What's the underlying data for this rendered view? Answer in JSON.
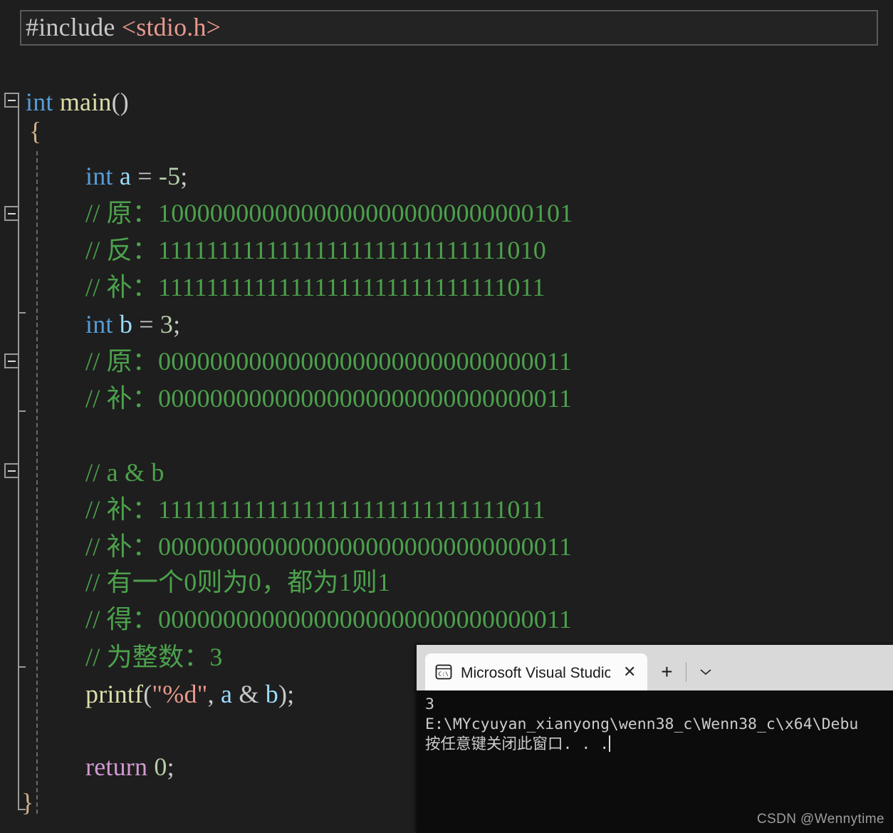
{
  "editor": {
    "language": "c",
    "theme_bg": "#1e1e1e",
    "current_line_index": 0,
    "lines": [
      {
        "indent": 0,
        "text": "#include <stdio.h>"
      },
      {
        "indent": 0,
        "text": ""
      },
      {
        "indent": 0,
        "text": "int main()"
      },
      {
        "indent": 0,
        "text": "{"
      },
      {
        "indent": 1,
        "text": ""
      },
      {
        "indent": 1,
        "text": "int a = -5;"
      },
      {
        "indent": 1,
        "text": "// 原：10000000000000000000000000000101"
      },
      {
        "indent": 1,
        "text": "// 反：11111111111111111111111111111010"
      },
      {
        "indent": 1,
        "text": "// 补：11111111111111111111111111111011"
      },
      {
        "indent": 1,
        "text": "int b = 3;"
      },
      {
        "indent": 1,
        "text": "// 原：00000000000000000000000000000011"
      },
      {
        "indent": 1,
        "text": "// 补：00000000000000000000000000000011"
      },
      {
        "indent": 1,
        "text": ""
      },
      {
        "indent": 1,
        "text": "// a & b"
      },
      {
        "indent": 1,
        "text": "// 补：11111111111111111111111111111011"
      },
      {
        "indent": 1,
        "text": "// 补：00000000000000000000000000000011"
      },
      {
        "indent": 1,
        "text": "// 有一个0则为0，都为1则1"
      },
      {
        "indent": 1,
        "text": "// 得：00000000000000000000000000000011"
      },
      {
        "indent": 1,
        "text": "// 为整数：3"
      },
      {
        "indent": 1,
        "text": "printf(\"%d\", a & b);"
      },
      {
        "indent": 1,
        "text": ""
      },
      {
        "indent": 1,
        "text": "return 0;"
      },
      {
        "indent": 0,
        "text": "}"
      }
    ],
    "tokens": {
      "preprocessor": "#include",
      "header": "<stdio.h>",
      "kw_int": "int",
      "fn_main": "main",
      "fn_printf": "printf",
      "kw_return": "return",
      "var_a": "a",
      "var_b": "b",
      "num_neg5": "-5",
      "num_3": "3",
      "num_0": "0",
      "fmt_string": "\"%d\"",
      "open_brace": "{",
      "close_brace": "}",
      "comment_yuan_a": "// 原：10000000000000000000000000000101",
      "comment_fan_a": "// 反：11111111111111111111111111111010",
      "comment_bu_a": "// 补：11111111111111111111111111111011",
      "comment_yuan_b": "// 原：00000000000000000000000000000011",
      "comment_bu_b": "// 补：00000000000000000000000000000011",
      "comment_and": "// a & b",
      "comment_bu_a2": "// 补：11111111111111111111111111111011",
      "comment_bu_b2": "// 补：00000000000000000000000000000011",
      "comment_rule": "// 有一个0则为0，都为1则1",
      "comment_de": "// 得：00000000000000000000000000000011",
      "comment_result": "// 为整数：3"
    },
    "colors": {
      "background": "#1e1e1e",
      "keyword": "#569cd6",
      "function": "#dcdcaa",
      "comment": "#4ca14c",
      "string": "#e8998d",
      "number": "#b5cea8",
      "variable": "#9cdcfe",
      "return_keyword": "#d19ad1",
      "punctuation": "#c8c8c8",
      "brace": "#d2b48c",
      "gutter_fold": "#9a9a9a",
      "indent_guide": "#6a6a6a",
      "current_line_border": "#5a5a5a"
    }
  },
  "terminal": {
    "tab": {
      "icon": "command-prompt-icon",
      "title": "Microsoft Visual Studio 调试控制台",
      "title_visible": "Microsoft Visual Studio 调试挖",
      "close_label": "✕"
    },
    "new_tab_label": "+",
    "dropdown_icon": "chevron-down-icon",
    "output": [
      "3",
      "E:\\MYcyuyan_xianyong\\wenn38_c\\Wenn38_c\\x64\\Debu",
      "按任意键关闭此窗口. . ."
    ],
    "colors": {
      "tabbar_background": "#d9d9d9",
      "active_tab_background": "#fbfbfb",
      "body_background": "#0c0c0c",
      "text": "#cccccc"
    }
  },
  "watermark": {
    "text": "CSDN @Wennytime"
  }
}
